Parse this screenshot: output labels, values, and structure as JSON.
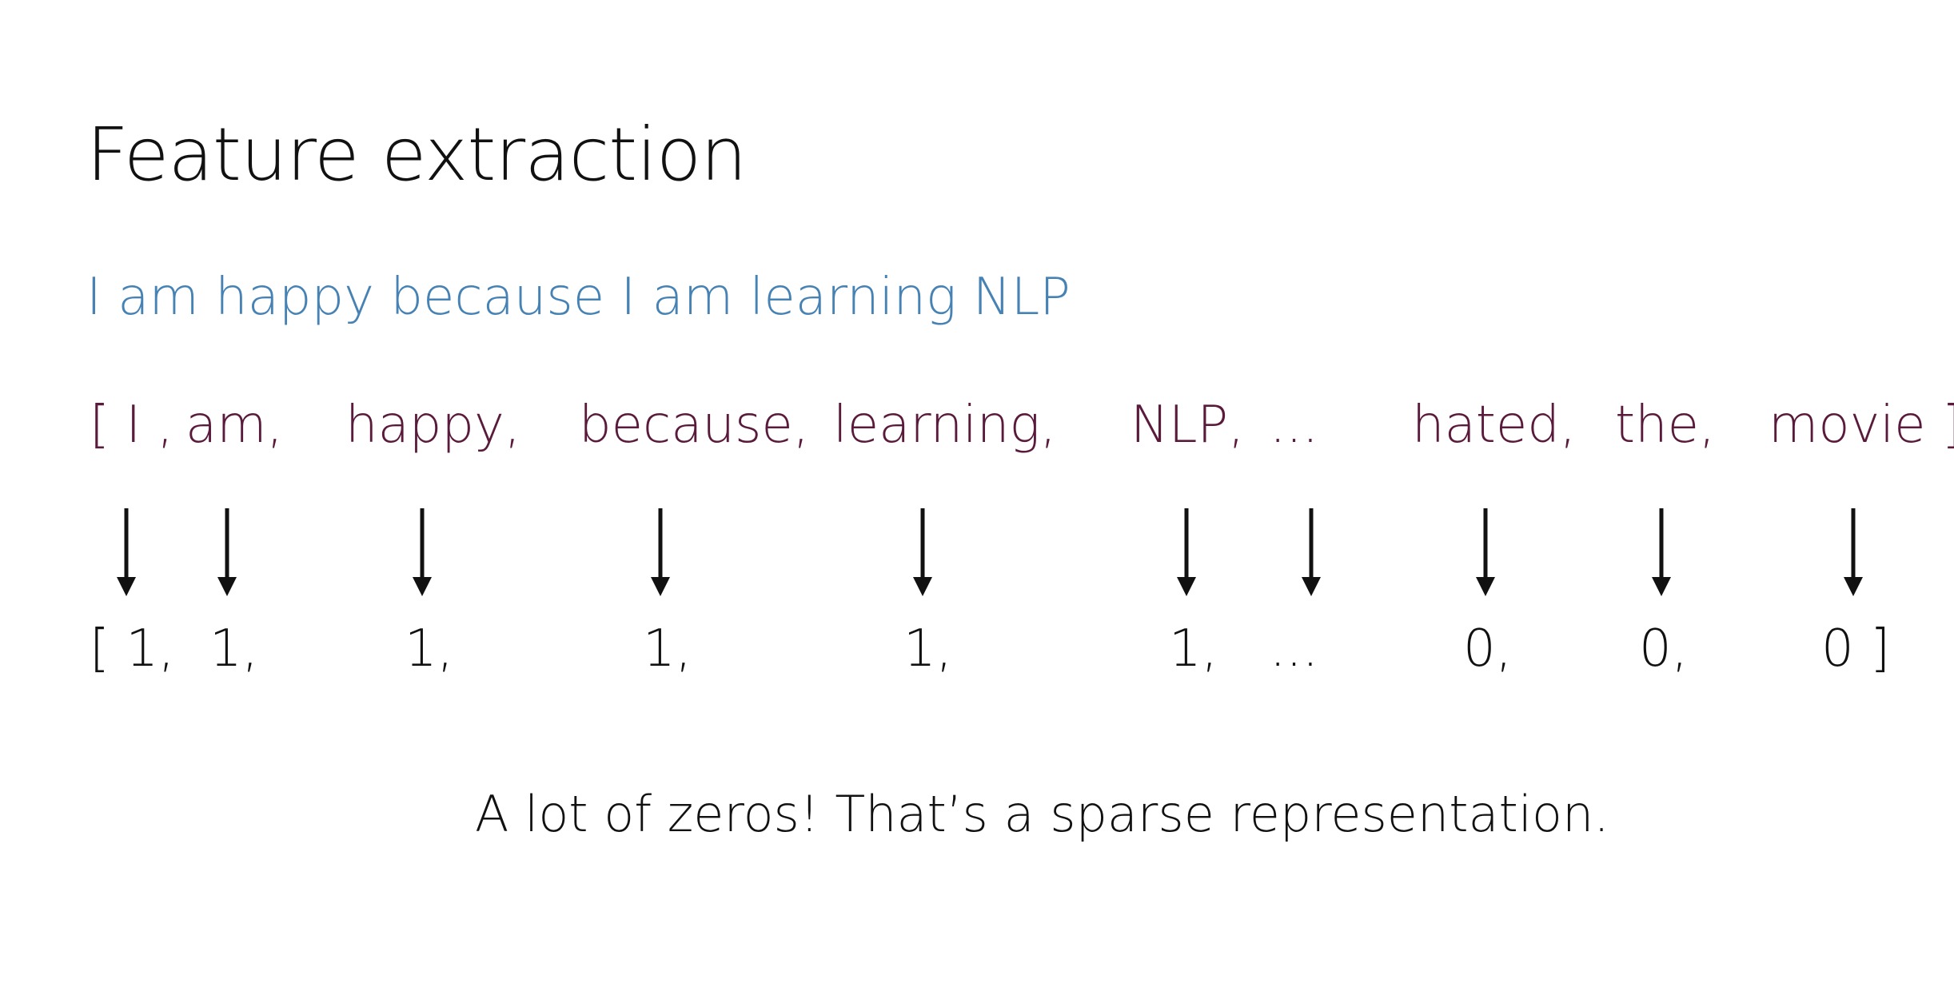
{
  "title": "Feature extraction",
  "sentence": "I am happy because I am learning NLP",
  "vocabulary": [
    "[ I ,",
    "am,",
    "happy,",
    "because,",
    "learning,",
    "NLP,",
    "...",
    "hated,",
    "the,",
    "movie ]"
  ],
  "vector": [
    "[ 1,",
    "1,",
    "1,",
    "1,",
    "1,",
    "1,",
    "...",
    "0,",
    "0,",
    "0 ]"
  ],
  "caption": "A lot of zeros! That’s a sparse representation.",
  "colors": {
    "title": "#111111",
    "sentence": "#4682b4",
    "vocabulary": "#5a1a3c",
    "vector": "#111111",
    "arrow": "#111111"
  }
}
